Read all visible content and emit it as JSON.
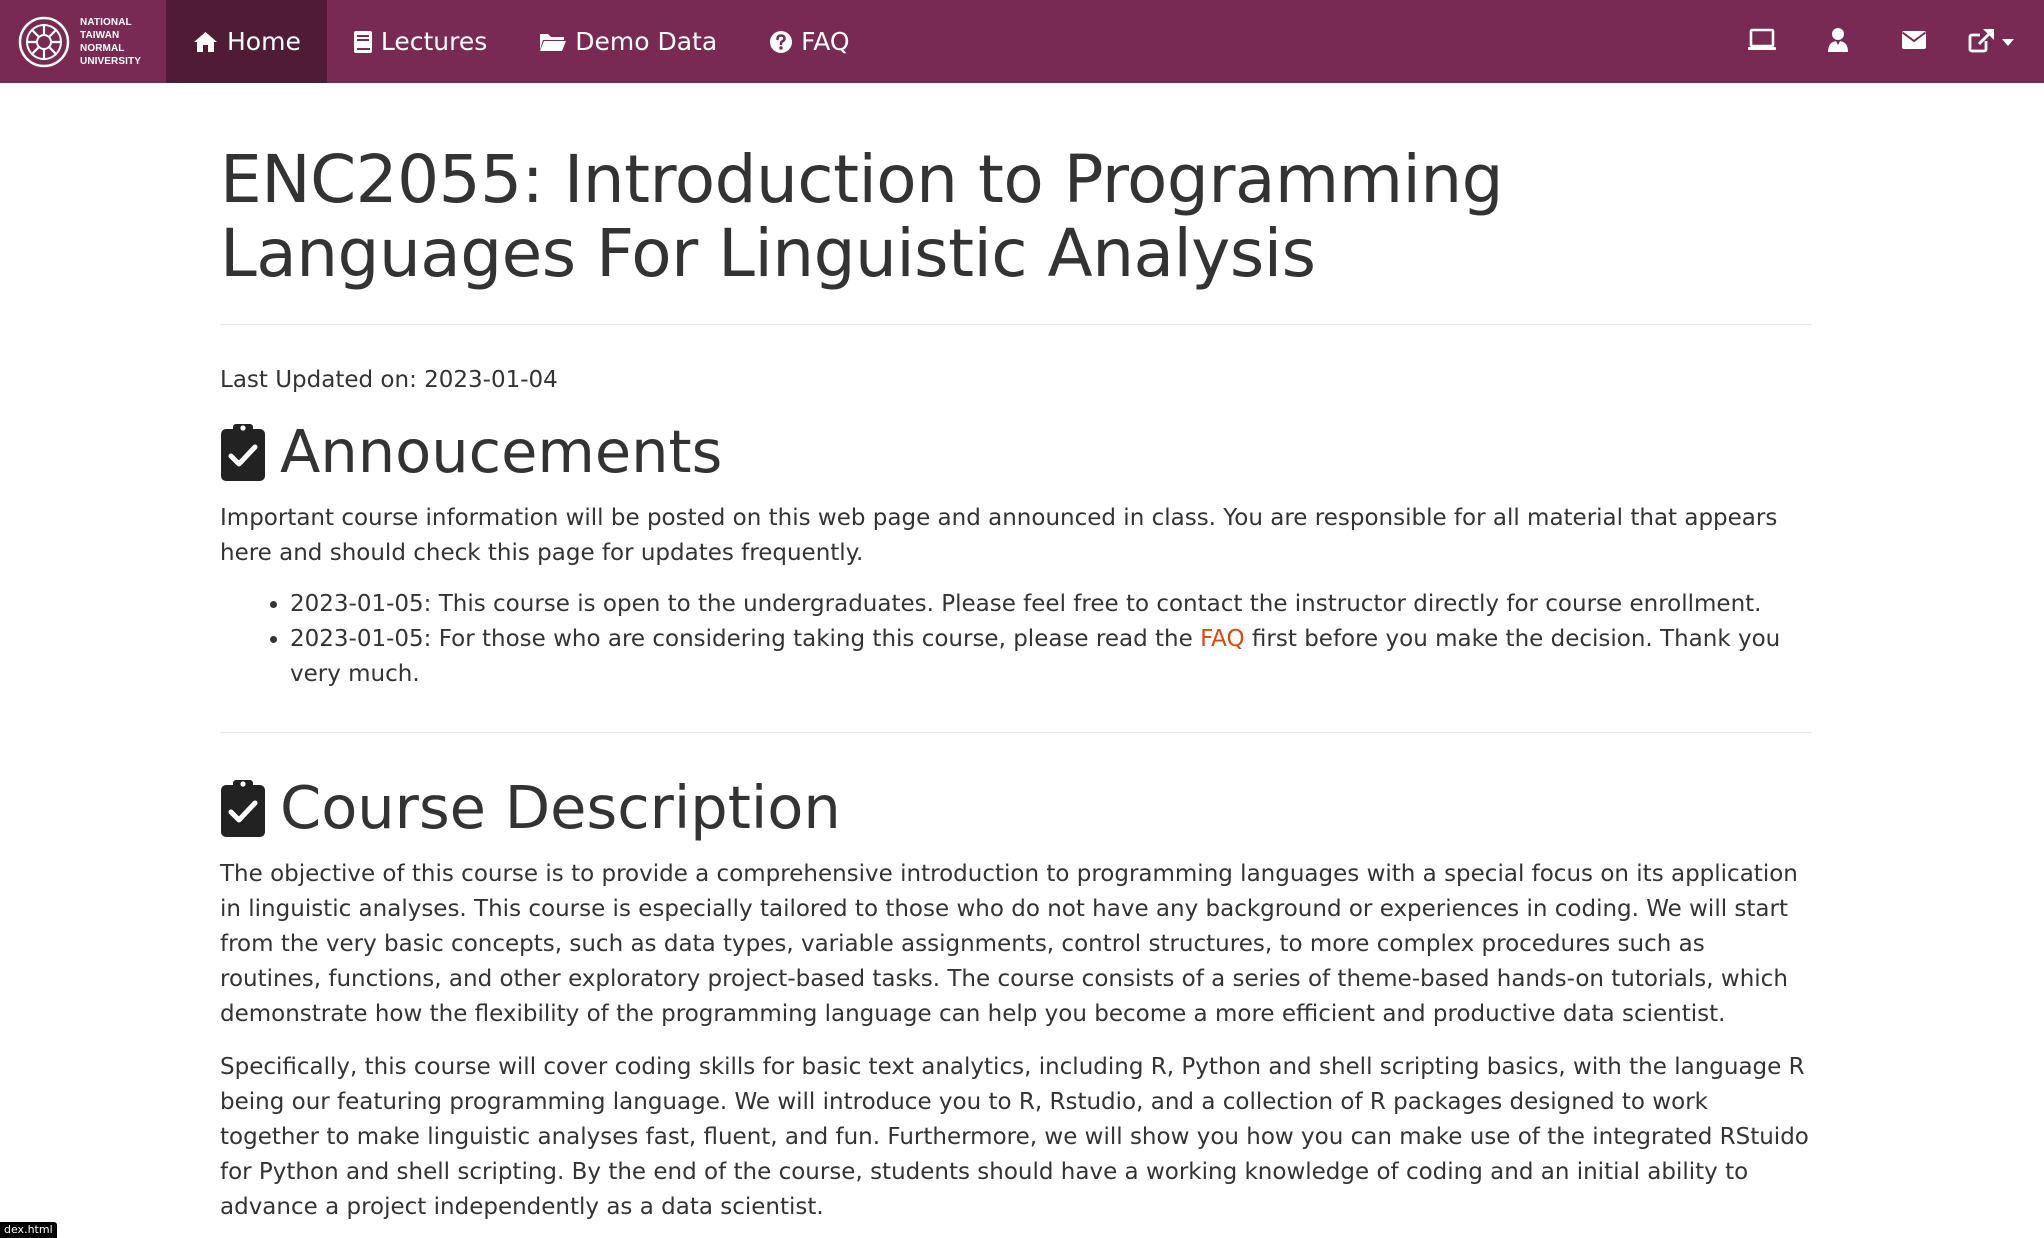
{
  "brand": {
    "lines": [
      "NATIONAL",
      "TAIWAN",
      "NORMAL",
      "UNIVERSITY"
    ]
  },
  "nav": {
    "items": [
      {
        "label": "Home",
        "icon": "home-icon",
        "active": true
      },
      {
        "label": "Lectures",
        "icon": "book-icon",
        "active": false
      },
      {
        "label": "Demo Data",
        "icon": "folder-open-icon",
        "active": false
      },
      {
        "label": "FAQ",
        "icon": "question-circle-icon",
        "active": false
      }
    ],
    "right_icons": [
      "laptop-icon",
      "user-icon",
      "envelope-icon",
      "external-link-icon"
    ]
  },
  "page": {
    "title": "ENC2055: Introduction to Programming Languages For Linguistic Analysis",
    "last_updated": "Last Updated on: 2023-01-04"
  },
  "announcements": {
    "heading": "Annoucements",
    "intro": "Important course information will be posted on this web page and announced in class. You are responsible for all material that appears here and should check this page for updates frequently.",
    "items": [
      {
        "text": "2023-01-05: This course is open to the undergraduates. Please feel free to contact the instructor directly for course enrollment."
      },
      {
        "before": "2023-01-05: For those who are considering taking this course, please read the ",
        "link": "FAQ",
        "after": " first before you make the decision. Thank you very much."
      }
    ]
  },
  "description": {
    "heading": "Course Description",
    "p1": "The objective of this course is to provide a comprehensive introduction to programming languages with a special focus on its application in linguistic analyses. This course is especially tailored to those who do not have any background or experiences in coding. We will start from the very basic concepts, such as data types, variable assignments, control structures, to more complex procedures such as routines, functions, and other exploratory project-based tasks. The course consists of a series of theme-based hands-on tutorials, which demonstrate how the flexibility of the programming language can help you become a more efficient and productive data scientist.",
    "p2": "Specifically, this course will cover coding skills for basic text analytics, including R, Python and shell scripting basics, with the language R being our featuring programming language. We will introduce you to R, Rstudio, and a collection of R packages designed to work together to make linguistic analyses fast, fluent, and fun. Furthermore, we will show you how you can make use of the integrated RStuido for Python and shell scripting. By the end of the course, students should have a working knowledge of coding and an initial ability to advance a project independently as a data scientist."
  },
  "status": {
    "text": "dex.html"
  },
  "colors": {
    "navbar": "#782a52",
    "navbar_active": "#4f1b35",
    "link": "#d9480f",
    "text": "#333333"
  }
}
